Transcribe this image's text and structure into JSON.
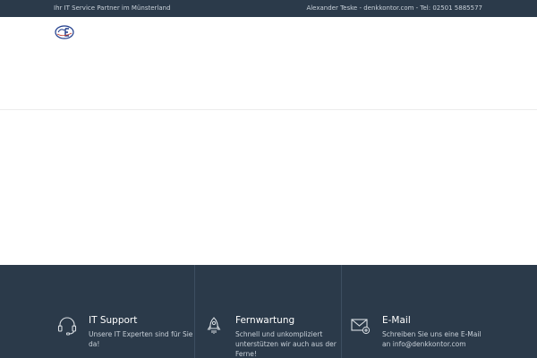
{
  "topbar": {
    "tagline": "Ihr IT Service Partner im Münsterland",
    "contact": "Alexander Teske - denkkontor.com - Tel: 02501 5885577"
  },
  "header": {
    "logo_icon": "denkkontor-logo-icon"
  },
  "colors": {
    "navy": "#2b3a4a",
    "muted_text": "#c9d1d9",
    "divider": "#3d4e60"
  },
  "features": [
    {
      "icon": "headset-icon",
      "title": "IT Support",
      "desc_line1": "Unsere IT Experten sind für Sie",
      "desc_line2": "da!"
    },
    {
      "icon": "rocket-icon",
      "title": "Fernwartung",
      "desc_line1": "Schnell und unkompliziert",
      "desc_line2": "unterstützen wir auch aus der",
      "desc_line3": "Ferne!"
    },
    {
      "icon": "mail-add-icon",
      "title": "E-Mail",
      "desc_line1": "Schreiben Sie uns eine E-Mail",
      "desc_line2": "an info@denkkontor.com"
    }
  ]
}
